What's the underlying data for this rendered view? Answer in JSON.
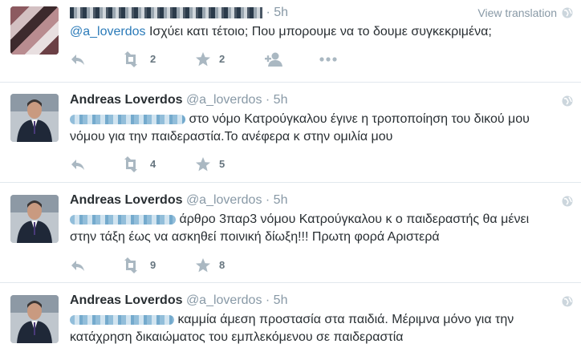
{
  "tweets": [
    {
      "handle": "",
      "time": "5h",
      "view_translation": "View translation",
      "mention": "@a_loverdos",
      "text": " Ισχύει κατι τέτοιο; Που μπορουμε να το δουμε συγκεκριμένα;",
      "retweets": "2",
      "favorites": "2"
    },
    {
      "fullname": "Andreas Loverdos",
      "handle": "@a_loverdos",
      "time": "5h",
      "text_line1": " στο νόμο Κατρούγκαλου έγινε η τροποποίηση του δικού μου",
      "text_line2": "νόμου για την παιδεραστία.Το ανέφερα κ στην ομιλία μου",
      "retweets": "4",
      "favorites": "5"
    },
    {
      "fullname": "Andreas Loverdos",
      "handle": "@a_loverdos",
      "time": "5h",
      "text_line1": " άρθρο 3παρ3 νόμου Κατρούγκαλου κ ο παιδεραστής θα μένει",
      "text_line2": "στην τάξη έως να ασκηθεί ποινική δίωξη!!! Πρωτη φορά Αριστερά",
      "retweets": "9",
      "favorites": "8"
    },
    {
      "fullname": "Andreas Loverdos",
      "handle": "@a_loverdos",
      "time": "5h",
      "text_line1": " καμμία άμεση  προστασία στα παιδιά. Μέριμνα μόνο για την",
      "text_line2": "κατάχρηση δικαιώματος του εμπλεκόμενου σε παιδεραστία"
    }
  ],
  "colors": {
    "link": "#2b7bb9",
    "muted": "#8899a6",
    "separator": "#e1e8ed"
  }
}
